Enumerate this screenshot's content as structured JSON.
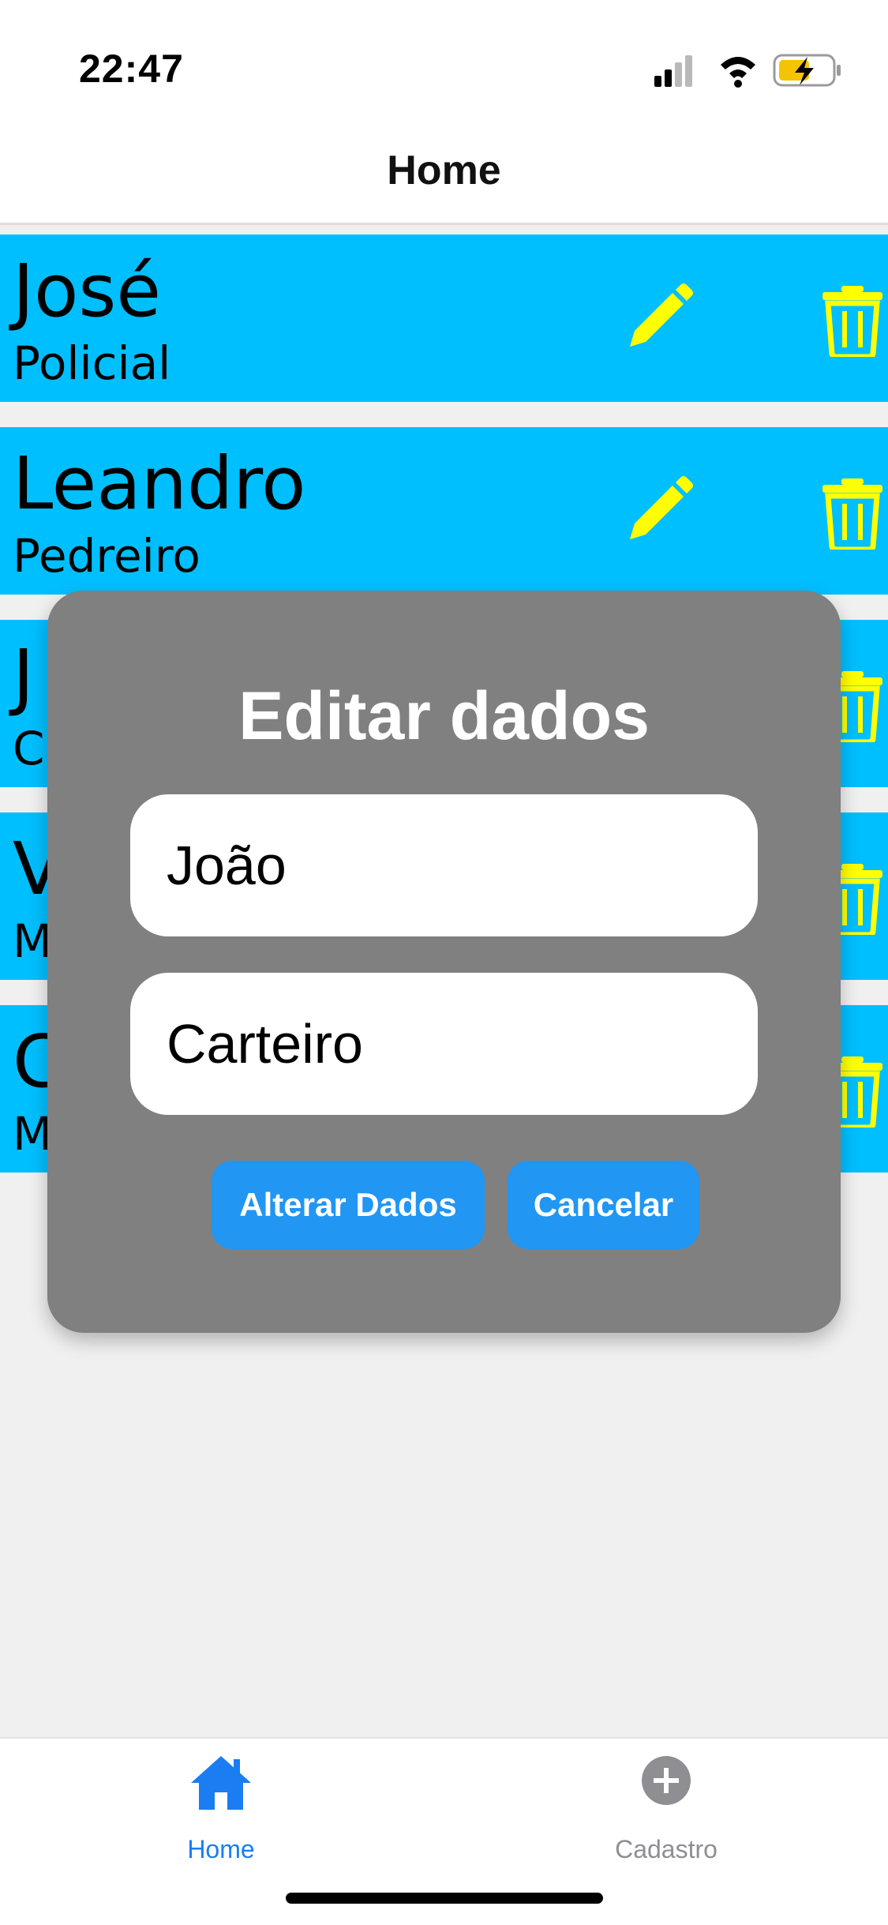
{
  "status_bar": {
    "time": "22:47"
  },
  "header": {
    "title": "Home"
  },
  "people": [
    {
      "name": "José",
      "role": "Policial"
    },
    {
      "name": "Leandro",
      "role": "Pedreiro"
    },
    {
      "name": "J",
      "role": "C"
    },
    {
      "name": "V",
      "role": "M"
    },
    {
      "name": "C",
      "role": "M"
    }
  ],
  "modal": {
    "title": "Editar dados",
    "name_value": "João",
    "role_value": "Carteiro",
    "confirm_label": "Alterar Dados",
    "cancel_label": "Cancelar"
  },
  "tabs": [
    {
      "label": "Home",
      "icon": "home-icon",
      "active": true
    },
    {
      "label": "Cadastro",
      "icon": "plus-circle-icon",
      "active": false
    }
  ],
  "colors": {
    "card_bg": "#00bfff",
    "icon_yellow": "#ffff00",
    "modal_bg": "#808080",
    "button_blue": "#2196f3",
    "tab_active": "#1a7df2",
    "tab_inactive": "#8e8e93"
  }
}
